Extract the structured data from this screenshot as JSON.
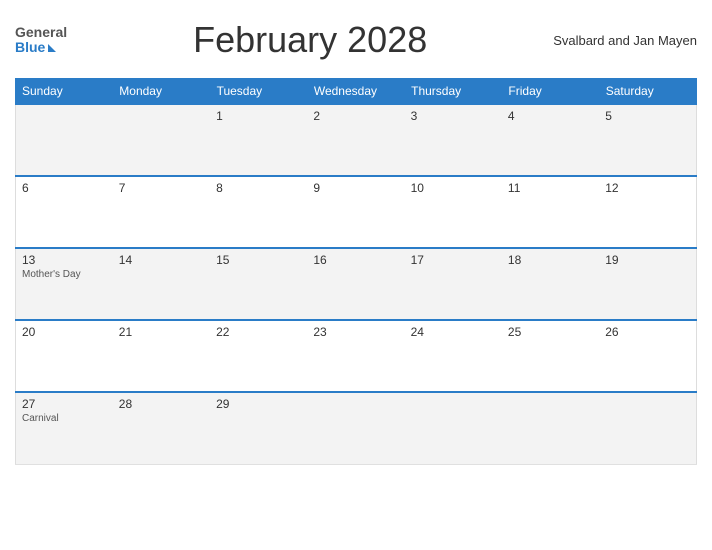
{
  "header": {
    "logo_general": "General",
    "logo_blue": "Blue",
    "title": "February 2028",
    "region": "Svalbard and Jan Mayen"
  },
  "days_of_week": [
    "Sunday",
    "Monday",
    "Tuesday",
    "Wednesday",
    "Thursday",
    "Friday",
    "Saturday"
  ],
  "weeks": [
    [
      {
        "day": "",
        "event": ""
      },
      {
        "day": "",
        "event": ""
      },
      {
        "day": "1",
        "event": ""
      },
      {
        "day": "2",
        "event": ""
      },
      {
        "day": "3",
        "event": ""
      },
      {
        "day": "4",
        "event": ""
      },
      {
        "day": "5",
        "event": ""
      }
    ],
    [
      {
        "day": "6",
        "event": ""
      },
      {
        "day": "7",
        "event": ""
      },
      {
        "day": "8",
        "event": ""
      },
      {
        "day": "9",
        "event": ""
      },
      {
        "day": "10",
        "event": ""
      },
      {
        "day": "11",
        "event": ""
      },
      {
        "day": "12",
        "event": ""
      }
    ],
    [
      {
        "day": "13",
        "event": "Mother's Day"
      },
      {
        "day": "14",
        "event": ""
      },
      {
        "day": "15",
        "event": ""
      },
      {
        "day": "16",
        "event": ""
      },
      {
        "day": "17",
        "event": ""
      },
      {
        "day": "18",
        "event": ""
      },
      {
        "day": "19",
        "event": ""
      }
    ],
    [
      {
        "day": "20",
        "event": ""
      },
      {
        "day": "21",
        "event": ""
      },
      {
        "day": "22",
        "event": ""
      },
      {
        "day": "23",
        "event": ""
      },
      {
        "day": "24",
        "event": ""
      },
      {
        "day": "25",
        "event": ""
      },
      {
        "day": "26",
        "event": ""
      }
    ],
    [
      {
        "day": "27",
        "event": "Carnival"
      },
      {
        "day": "28",
        "event": ""
      },
      {
        "day": "29",
        "event": ""
      },
      {
        "day": "",
        "event": ""
      },
      {
        "day": "",
        "event": ""
      },
      {
        "day": "",
        "event": ""
      },
      {
        "day": "",
        "event": ""
      }
    ]
  ]
}
